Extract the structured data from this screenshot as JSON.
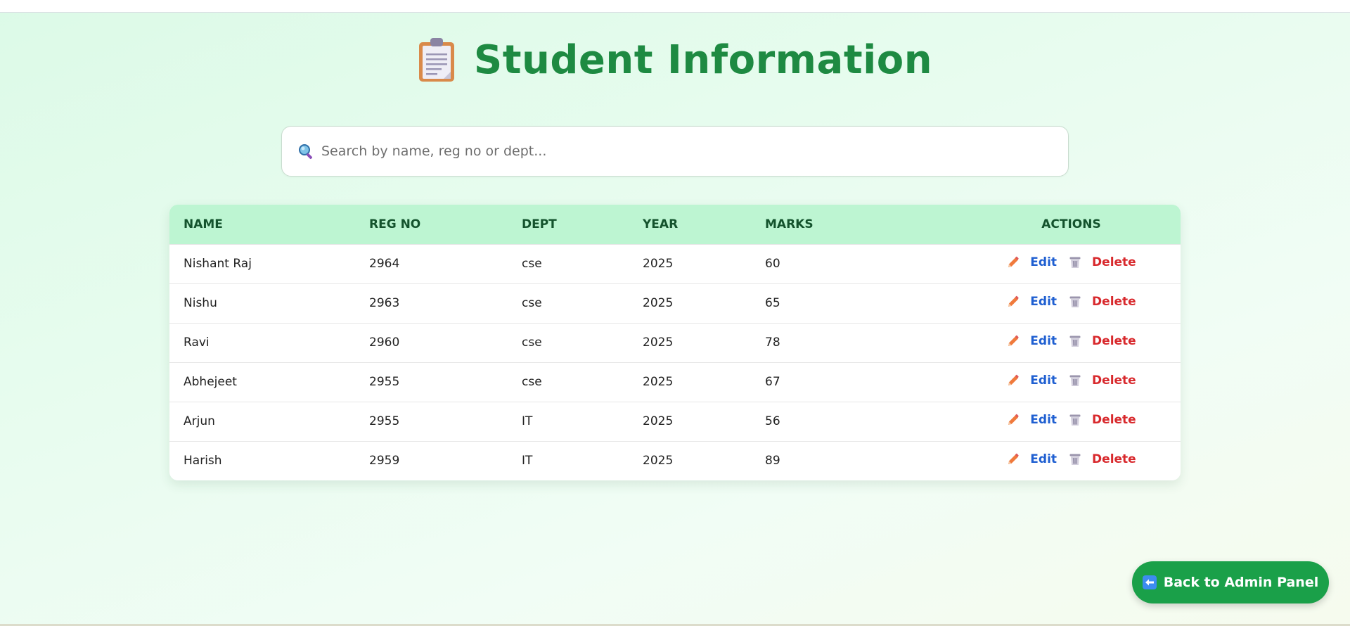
{
  "page": {
    "title": "Student Information",
    "title_icon": "clipboard-icon"
  },
  "search": {
    "placeholder": "Search by name, reg no or dept...",
    "value": "",
    "icon": "magnifier-icon"
  },
  "table": {
    "columns": [
      "NAME",
      "REG NO",
      "DEPT",
      "YEAR",
      "MARKS",
      "ACTIONS"
    ],
    "rows": [
      {
        "name": "Nishant Raj",
        "reg_no": "2964",
        "dept": "cse",
        "year": "2025",
        "marks": "60"
      },
      {
        "name": "Nishu",
        "reg_no": "2963",
        "dept": "cse",
        "year": "2025",
        "marks": "65"
      },
      {
        "name": "Ravi",
        "reg_no": "2960",
        "dept": "cse",
        "year": "2025",
        "marks": "78"
      },
      {
        "name": "Abhejeet",
        "reg_no": "2955",
        "dept": "cse",
        "year": "2025",
        "marks": "67"
      },
      {
        "name": "Arjun",
        "reg_no": "2955",
        "dept": "IT",
        "year": "2025",
        "marks": "56"
      },
      {
        "name": "Harish",
        "reg_no": "2959",
        "dept": "IT",
        "year": "2025",
        "marks": "89"
      }
    ],
    "edit_label": "Edit",
    "delete_label": "Delete",
    "edit_icon": "pencil-icon",
    "delete_icon": "trash-icon"
  },
  "back_button": {
    "label": "Back to Admin Panel",
    "icon": "left-arrow-icon"
  },
  "colors": {
    "title": "#1e8a42",
    "header_bg": "#bdf5d2",
    "header_text": "#14532d",
    "edit": "#1f5fd1",
    "delete": "#d8282c",
    "button_bg": "#1aa049"
  }
}
